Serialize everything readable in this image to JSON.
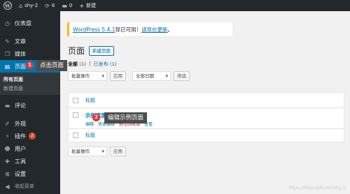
{
  "adminbar": {
    "site_name": "shy-2",
    "updates_count": "6",
    "comments_count": "0",
    "new_label": "新建"
  },
  "sidebar": {
    "items": [
      {
        "label": "仪表盘",
        "icon": "dashboard-icon",
        "glyph": "◷"
      },
      {
        "label": "文章",
        "icon": "pin-icon",
        "glyph": "✎"
      },
      {
        "label": "媒体",
        "icon": "media-icon",
        "glyph": "❐"
      },
      {
        "label": "页面",
        "icon": "page-icon",
        "glyph": "▤",
        "badge": "1"
      },
      {
        "label": "评论",
        "icon": "comment-icon",
        "glyph": "▬"
      },
      {
        "label": "外观",
        "icon": "brush-icon",
        "glyph": "✐"
      },
      {
        "label": "插件",
        "icon": "plugin-icon",
        "glyph": "⚡",
        "badge": "2"
      },
      {
        "label": "用户",
        "icon": "user-icon",
        "glyph": "☻"
      },
      {
        "label": "工具",
        "icon": "wrench-icon",
        "glyph": "✚"
      },
      {
        "label": "设置",
        "icon": "settings-icon",
        "glyph": "⊞"
      },
      {
        "label": "收起菜单",
        "icon": "collapse-icon",
        "glyph": "◀"
      }
    ],
    "submenu": [
      "所有页面",
      "新建页面"
    ]
  },
  "callouts": {
    "one": {
      "num": "1",
      "text": "点击页面"
    },
    "two": {
      "num": "2",
      "text": "编辑示例页面"
    }
  },
  "notice": {
    "prefix": "WordPress 5.4.1",
    "middle": "现已可用！",
    "link": "请现在更新",
    "suffix": "。"
  },
  "page": {
    "title": "页面",
    "add_new": "新建页面"
  },
  "views": {
    "all": "全部",
    "all_count": "(1)",
    "divider": "|",
    "published": "已发布",
    "published_count": "(1)"
  },
  "filters": {
    "bulk_action": "批量操作",
    "apply": "应用",
    "all_dates": "全部日期",
    "filter": "筛选"
  },
  "table": {
    "column_title": "标题",
    "row": {
      "title": "示例页面",
      "actions": [
        "编辑",
        "快速编辑",
        "移至回收站",
        "查看"
      ]
    }
  },
  "bottom_filters": {
    "bulk_action": "批量操作",
    "apply": "应用"
  },
  "watermark": "https://blog.csdn.net/shy_2"
}
